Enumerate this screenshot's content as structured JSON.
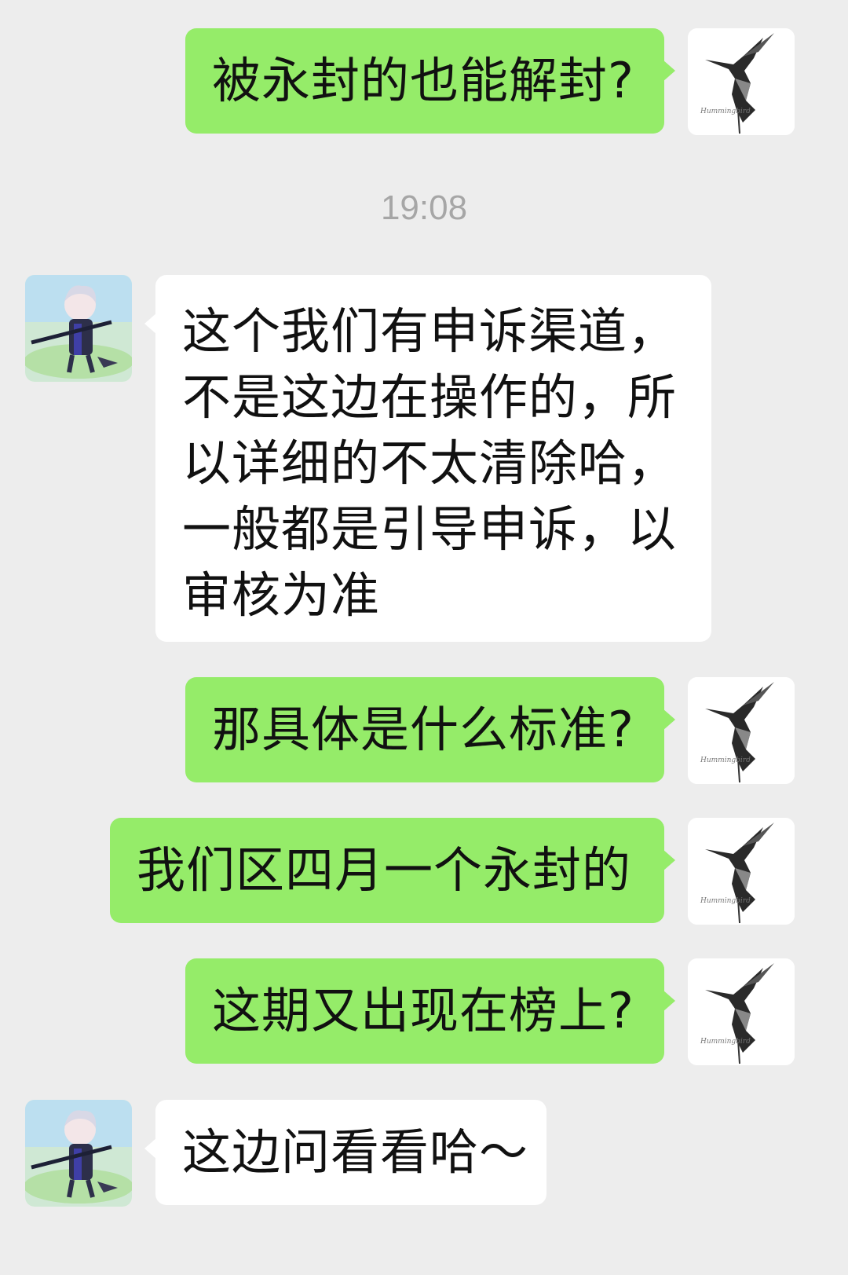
{
  "messages": [
    {
      "side": "me",
      "avatar_icon": "hummingbird-icon",
      "text": "被永封的也能解封?"
    },
    {
      "side": "system",
      "text": "19:08"
    },
    {
      "side": "other",
      "avatar_icon": "anime-character-icon",
      "text": "这个我们有申诉渠道，\n不是这边在操作的，所\n以详细的不太清除哈，\n一般都是引导申诉，以\n审核为准"
    },
    {
      "side": "me",
      "avatar_icon": "hummingbird-icon",
      "text": "那具体是什么标准?"
    },
    {
      "side": "me",
      "avatar_icon": "hummingbird-icon",
      "text": "我们区四月一个永封的"
    },
    {
      "side": "me",
      "avatar_icon": "hummingbird-icon",
      "text": "这期又出现在榜上?"
    },
    {
      "side": "other",
      "avatar_icon": "anime-character-icon",
      "text": "这边问看看哈～"
    }
  ],
  "colors": {
    "background": "#ededed",
    "mine_bubble": "#95ec69",
    "their_bubble": "#ffffff",
    "timestamp": "#a6a6a6"
  }
}
